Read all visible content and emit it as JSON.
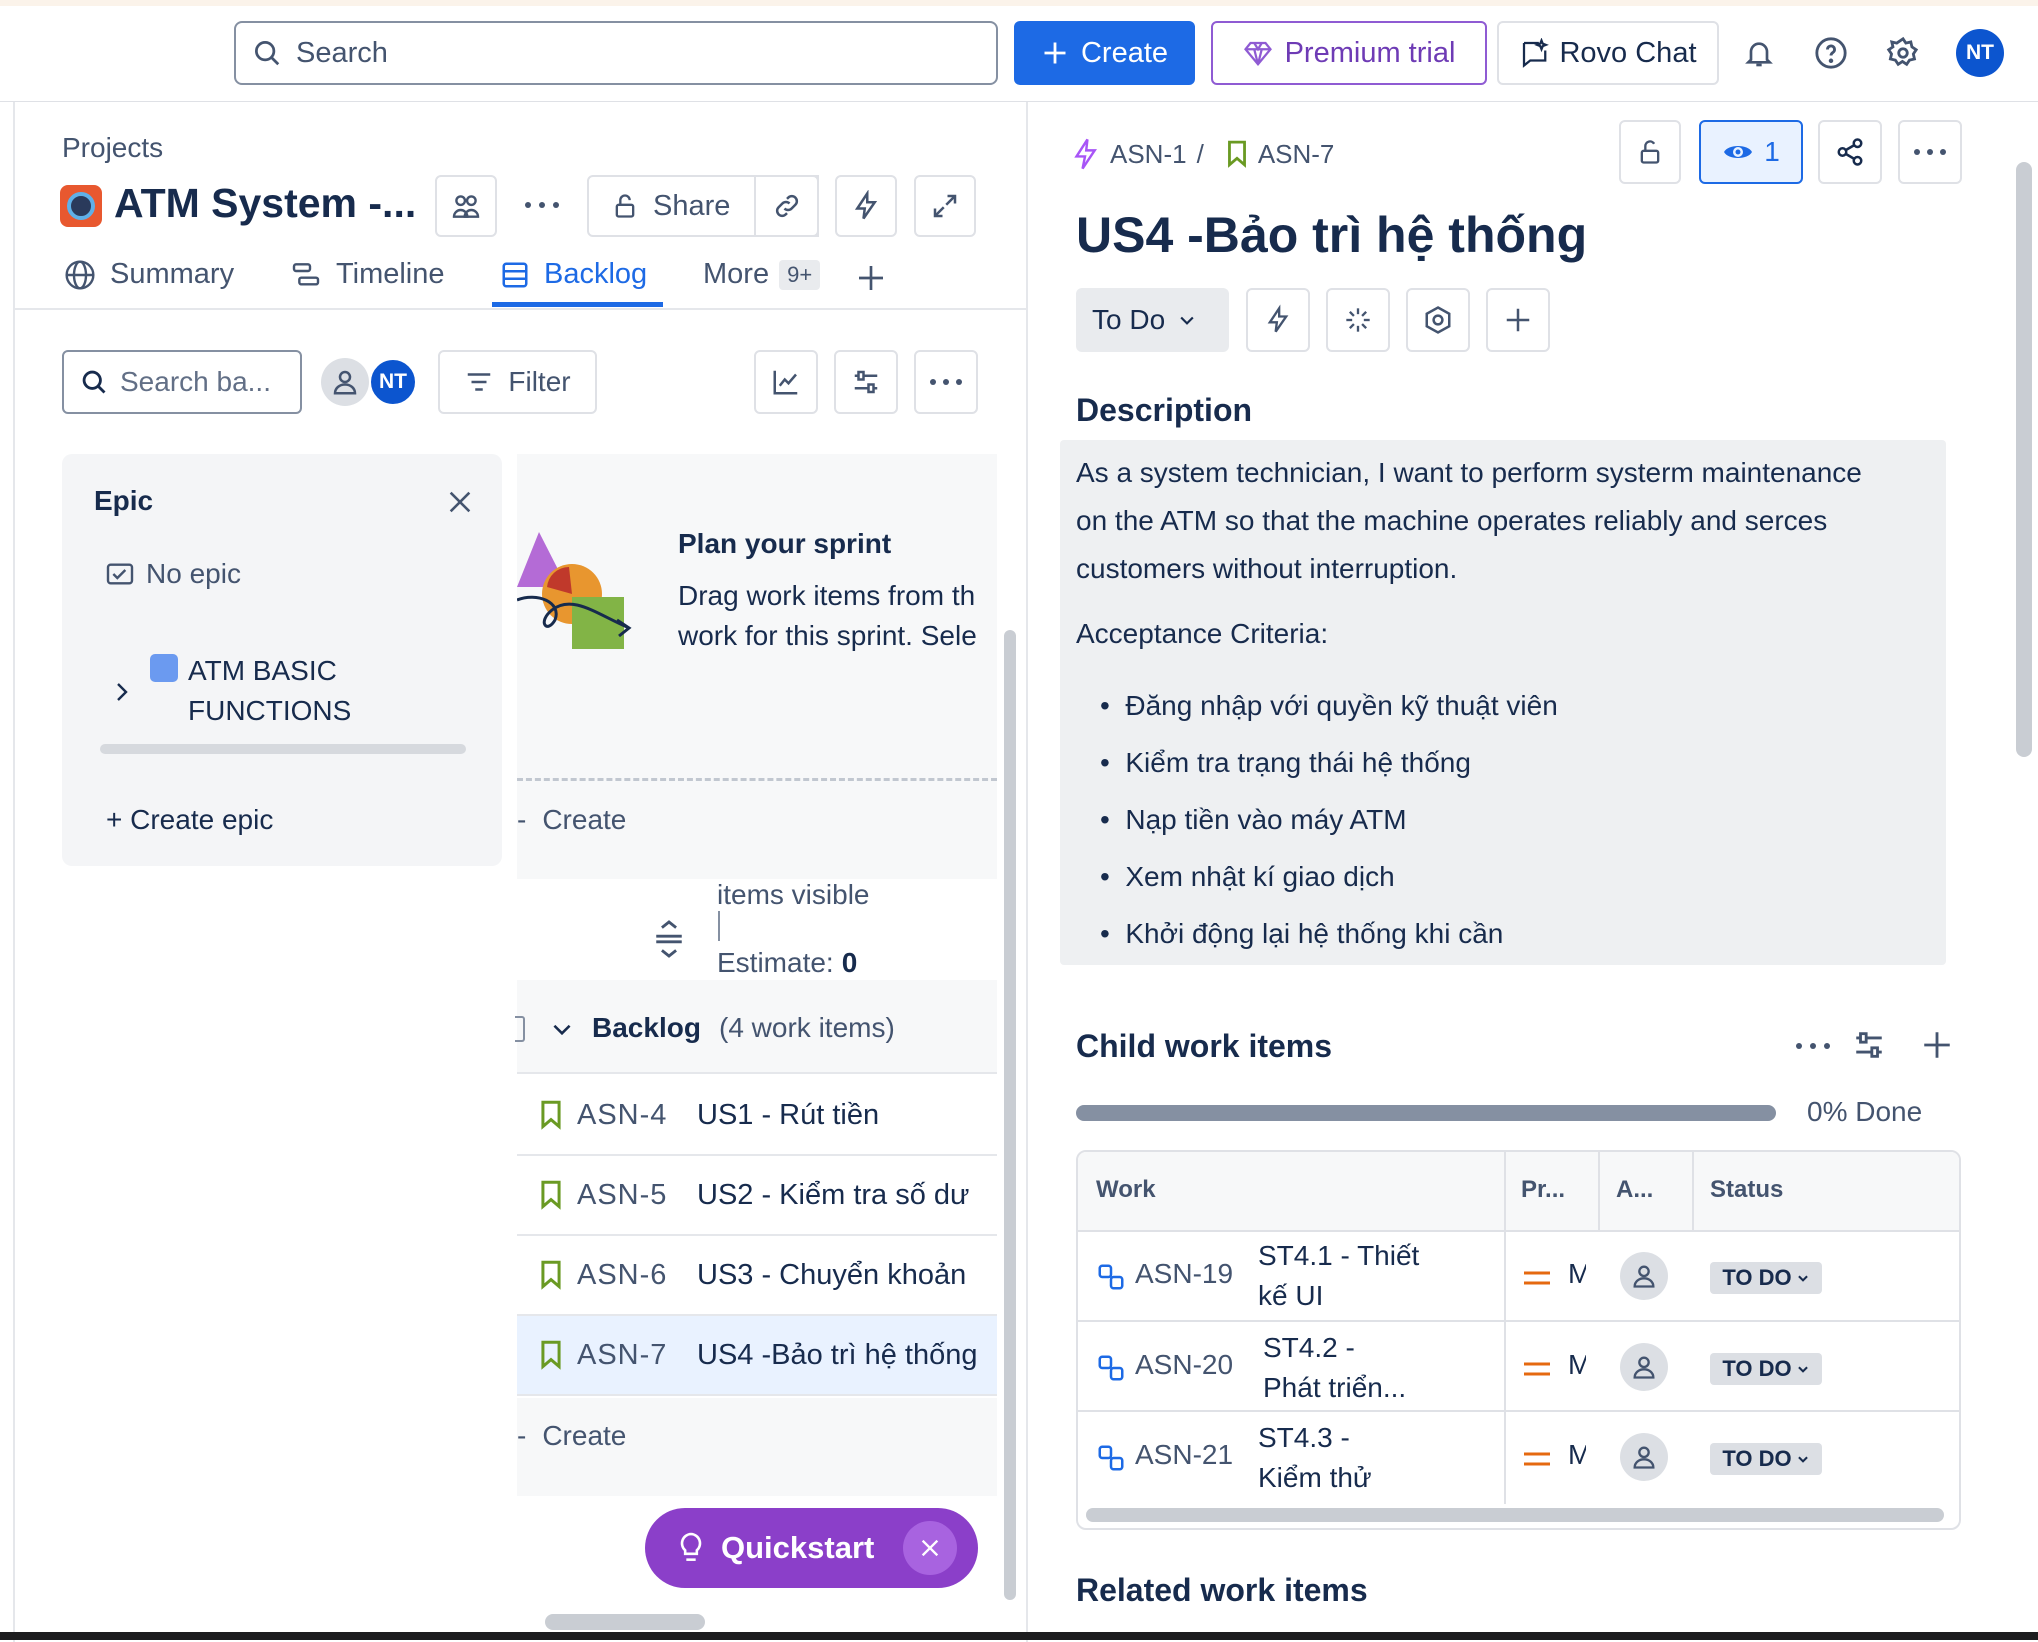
{
  "topbar": {
    "search_placeholder": "Search",
    "create_label": "Create",
    "premium_label": "Premium trial",
    "rovo_label": "Rovo Chat",
    "avatar_initials": "NT"
  },
  "project": {
    "breadcrumb": "Projects",
    "title": "ATM System -...",
    "share_label": "Share",
    "tabs": [
      {
        "label": "Summary"
      },
      {
        "label": "Timeline"
      },
      {
        "label": "Backlog"
      },
      {
        "label": "More"
      }
    ],
    "more_badge": "9+"
  },
  "backlog_toolbar": {
    "search_placeholder": "Search ba...",
    "avatar_initials": "NT",
    "filter_label": "Filter"
  },
  "epic_panel": {
    "title": "Epic",
    "no_epic": "No epic",
    "epic_line1": "ATM BASIC",
    "epic_line2": "FUNCTIONS",
    "create_epic": "+ Create epic"
  },
  "sprint": {
    "plan_title": "Plan your sprint",
    "plan_line1": "Drag work items from th",
    "plan_line2": "work for this sprint. Sele",
    "create_label": "Create",
    "items_visible": "items visible",
    "estimate_label": "Estimate:",
    "estimate_value": "0"
  },
  "backlog": {
    "title": "Backlog",
    "count": "(4 work items)",
    "items": [
      {
        "key": "ASN-4",
        "summary": "US1 - Rút tiền"
      },
      {
        "key": "ASN-5",
        "summary": "US2 - Kiểm tra số dư"
      },
      {
        "key": "ASN-6",
        "summary": "US3 - Chuyển khoản"
      },
      {
        "key": "ASN-7",
        "summary": "US4 -Bảo trì hệ thống"
      }
    ],
    "create_label": "Create",
    "quickstart_label": "Quickstart"
  },
  "detail": {
    "parent_key": "ASN-1",
    "separator": "/",
    "issue_key": "ASN-7",
    "watch_count": "1",
    "title": "US4 -Bảo trì hệ thống",
    "status": "To Do",
    "description_heading": "Description",
    "desc_line1": "As a system technician, I want to perform systerm maintenance",
    "desc_line2": "on the ATM so that the machine operates reliably and serces",
    "desc_line3": "customers without interruption.",
    "acceptance_heading": "Acceptance Criteria:",
    "criteria": [
      "Đăng nhập với quyền kỹ thuật viên",
      "Kiểm tra trạng thái hệ thống",
      "Nạp tiền vào máy ATM",
      "Xem nhật kí giao dịch",
      "Khởi động lại hệ thống khi cần"
    ],
    "child_heading": "Child work items",
    "progress_label": "0% Done",
    "progress_done": 0,
    "table_headers": [
      "Work",
      "Pr...",
      "A...",
      "Status"
    ],
    "children": [
      {
        "key": "ASN-19",
        "summary_1": "ST4.1 - Thiết",
        "summary_2": "kế UI",
        "priority": "M",
        "status": "TO DO"
      },
      {
        "key": "ASN-20",
        "summary_1": "ST4.2 -",
        "summary_2": "Phát triển...",
        "priority": "M",
        "status": "TO DO"
      },
      {
        "key": "ASN-21",
        "summary_1": "ST4.3 -",
        "summary_2": "Kiểm thử",
        "priority": "M",
        "status": "TO DO"
      }
    ],
    "related_heading": "Related work items"
  },
  "colors": {
    "accent": "#1d6ae5",
    "premium": "#6e3bb5",
    "quickstart": "#8b3fc9",
    "story_green": "#6a9a23",
    "subtask_blue": "#1d6ae5",
    "priority_orange": "#e56910"
  }
}
